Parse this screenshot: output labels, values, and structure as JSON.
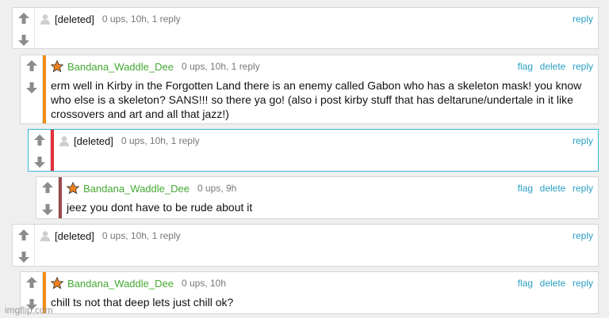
{
  "comments": [
    {
      "user": "[deleted]",
      "meta": "0 ups, 10h, 1 reply",
      "actions": [
        "reply"
      ],
      "text": ""
    },
    {
      "user": "Bandana_Waddle_Dee",
      "meta": "0 ups, 10h, 1 reply",
      "actions": [
        "flag",
        "delete",
        "reply"
      ],
      "text": "erm well in Kirby in the Forgotten Land there is an enemy called Gabon who has a skeleton mask! you know who else is a skeleton? SANS!!! so there ya go! (also i post kirby stuff that has deltarune/undertale in it like crossovers and art and all that jazz!)"
    },
    {
      "user": "[deleted]",
      "meta": "0 ups, 10h, 1 reply",
      "actions": [
        "reply"
      ],
      "text": ""
    },
    {
      "user": "Bandana_Waddle_Dee",
      "meta": "0 ups, 9h",
      "actions": [
        "flag",
        "delete",
        "reply"
      ],
      "text": "jeez you dont have to be rude about it"
    },
    {
      "user": "[deleted]",
      "meta": "0 ups, 10h, 1 reply",
      "actions": [
        "reply"
      ],
      "text": ""
    },
    {
      "user": "Bandana_Waddle_Dee",
      "meta": "0 ups, 10h",
      "actions": [
        "flag",
        "delete",
        "reply"
      ],
      "text": "chill ts not that deep lets just chill ok?"
    }
  ],
  "colors": {
    "stripe_orange": "#f08c16",
    "stripe_red": "#e0303a",
    "stripe_maroon": "#9b4b4b",
    "link_blue": "#2a9fc2",
    "user_green": "#44a832",
    "selected_border": "#3ab7d6"
  },
  "icons": {
    "upvote": "arrow-up-icon",
    "downvote": "arrow-down-icon",
    "deleted_avatar": "user-silhouette-icon",
    "user_avatar": "star-icon"
  },
  "watermark": "imgflip.com"
}
